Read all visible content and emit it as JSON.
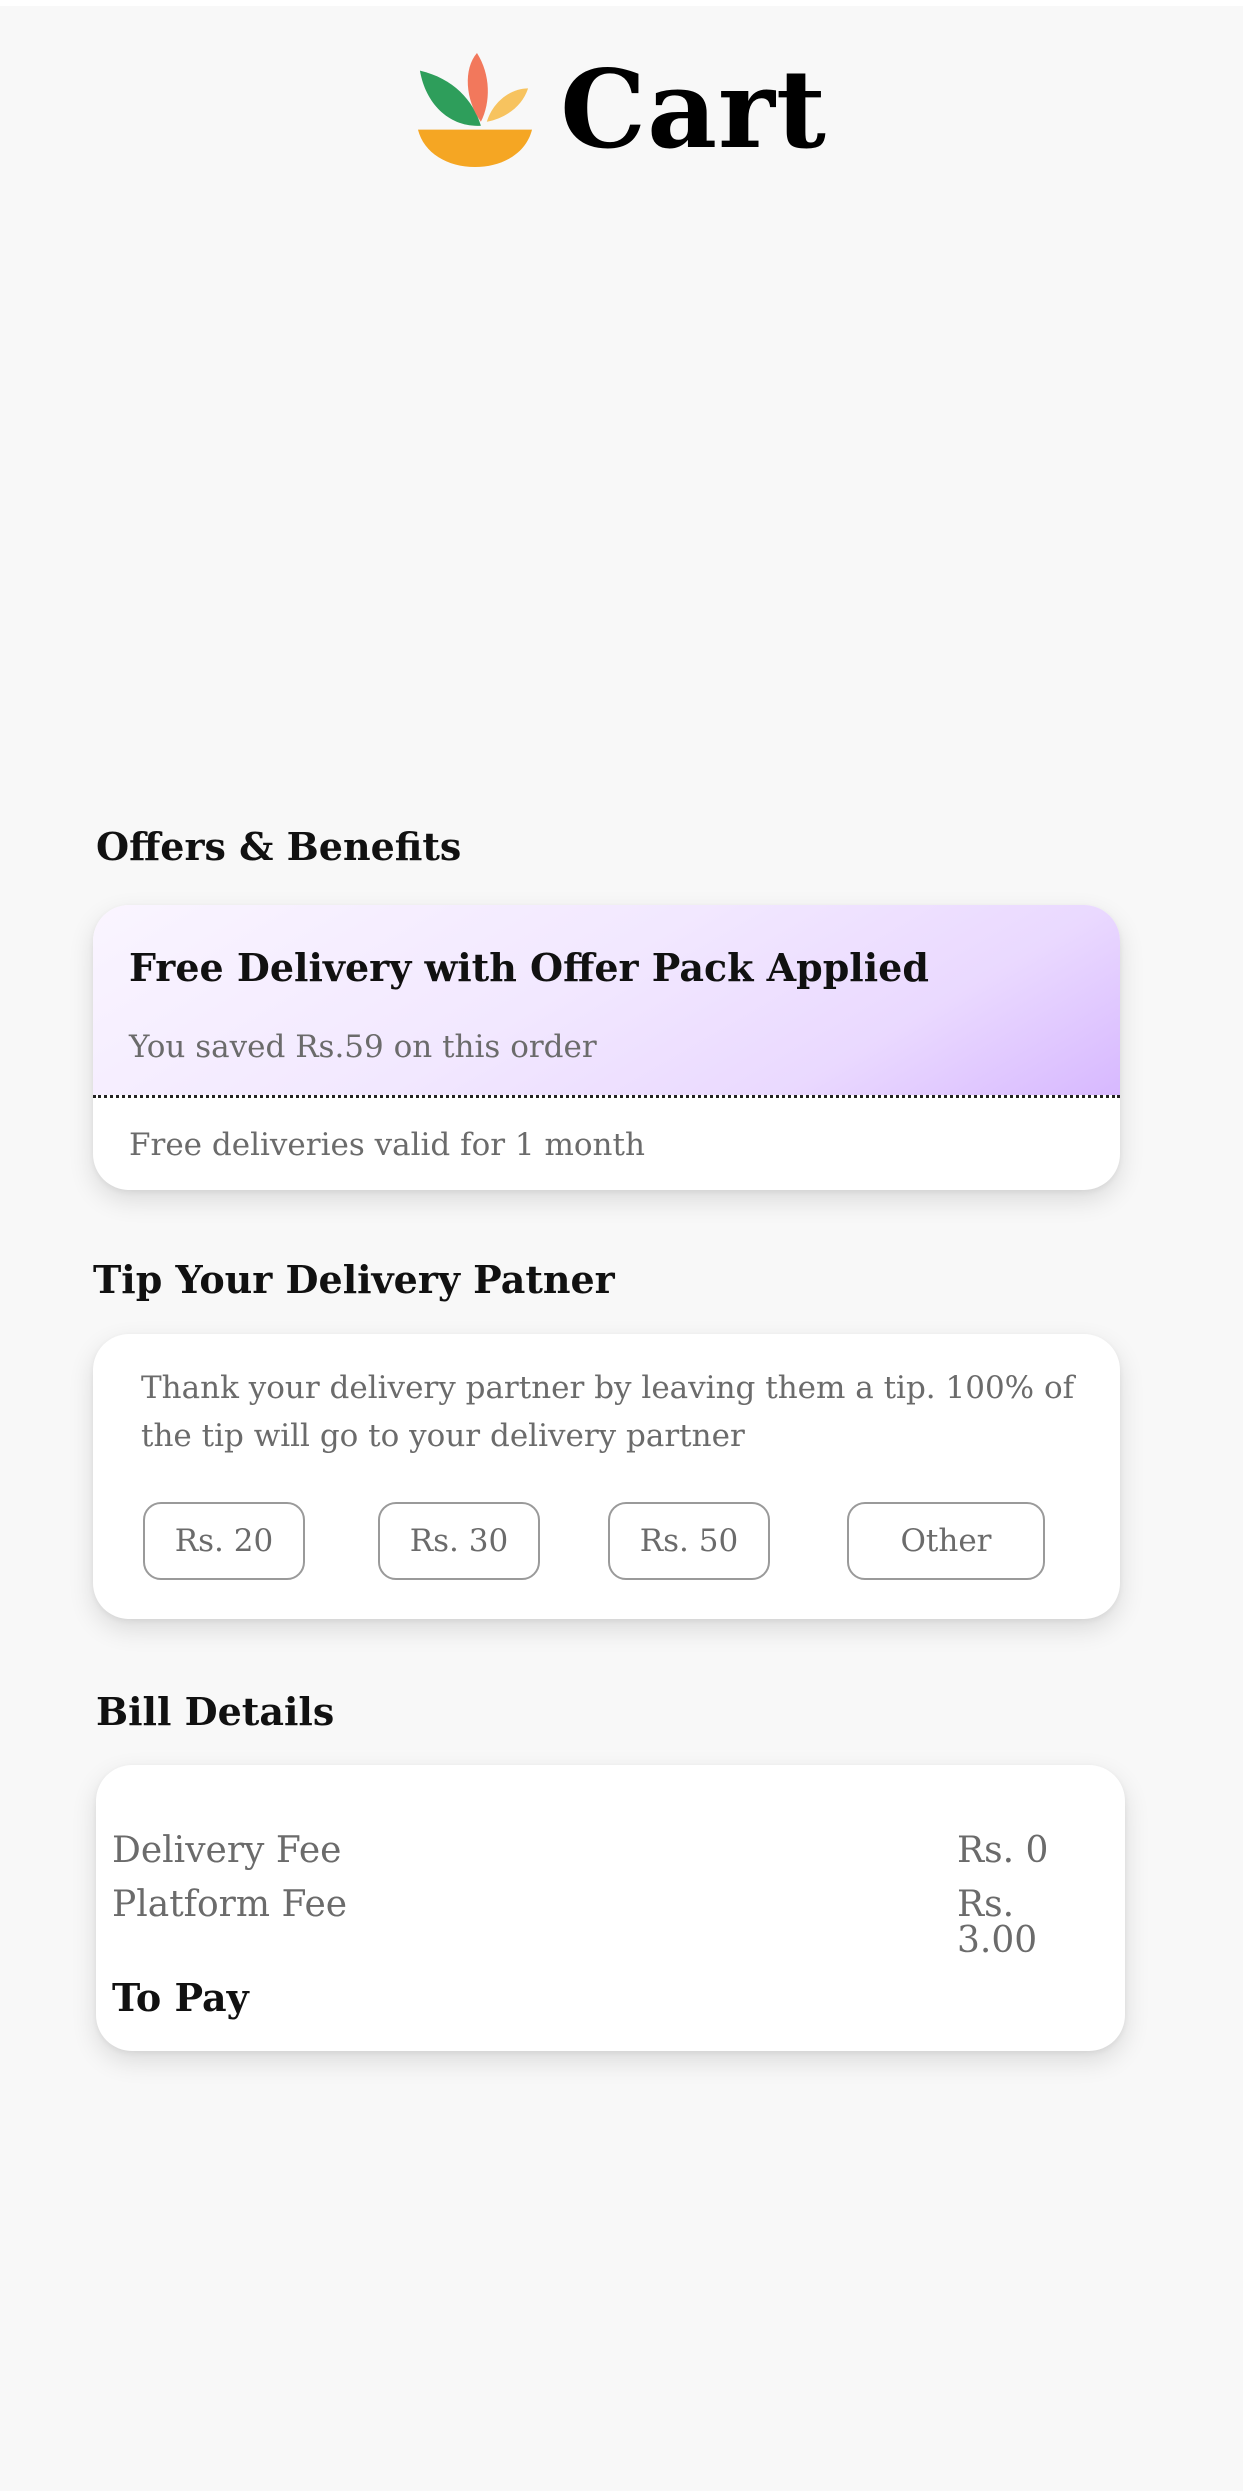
{
  "header": {
    "title": "Cart",
    "logo_icon": "flower-bowl-logo"
  },
  "offers": {
    "section_title": "Offers & Benefits",
    "offer_title": "Free Delivery with Offer Pack Applied",
    "offer_saved": "You saved Rs.59 on this order",
    "offer_validity": "Free deliveries valid for 1 month",
    "gradient_accent": "#d7b8ff"
  },
  "tip": {
    "section_title": "Tip Your Delivery Patner",
    "description": "Thank your delivery partner by leaving them a tip. 100% of the tip will go to your delivery partner",
    "options": [
      "Rs. 20",
      "Rs. 30",
      "Rs. 50",
      "Other"
    ]
  },
  "bill": {
    "section_title": "Bill Details",
    "rows": [
      {
        "label": "Delivery Fee",
        "value": "Rs. 0"
      },
      {
        "label": "Platform Fee",
        "value": "Rs. 3.00"
      }
    ],
    "total_label": "To Pay"
  },
  "colors": {
    "background": "#f8f8f8",
    "card": "#ffffff",
    "muted_text": "#6b6b6b",
    "logo_green": "#2e9e5b",
    "logo_coral": "#f2785c",
    "logo_yellow": "#f7c35f",
    "logo_orange": "#f5a623"
  }
}
